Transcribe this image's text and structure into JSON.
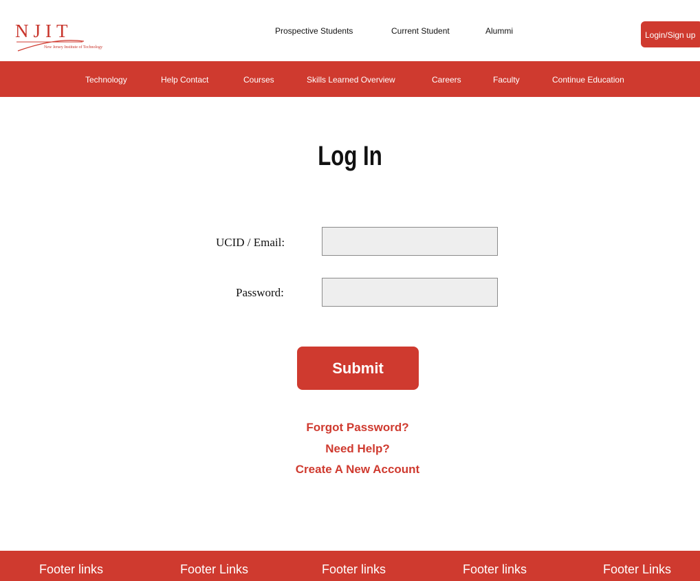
{
  "brand": {
    "logo_text": "NJIT",
    "logo_subtitle": "New Jersey Institute of Technology",
    "color": "#cf3a2f"
  },
  "top_nav": {
    "items": [
      "Prospective Students",
      "Current Student",
      "Alummi"
    ],
    "login_label": "Login/Sign up"
  },
  "main_nav": {
    "items": [
      "Technology",
      "Help Contact",
      "Courses",
      "Skills Learned Overview",
      "Careers",
      "Faculty",
      "Continue Education"
    ]
  },
  "page": {
    "title": "Log In"
  },
  "form": {
    "ucid_label": "UCID / Email:",
    "ucid_value": "",
    "password_label": "Password:",
    "password_value": "",
    "submit_label": "Submit"
  },
  "help_links": [
    "Forgot Password?",
    "Need Help?",
    "Create A New Account"
  ],
  "footer": {
    "links": [
      "Footer links",
      "Footer Links",
      "Footer links",
      "Footer links",
      "Footer Links"
    ]
  }
}
